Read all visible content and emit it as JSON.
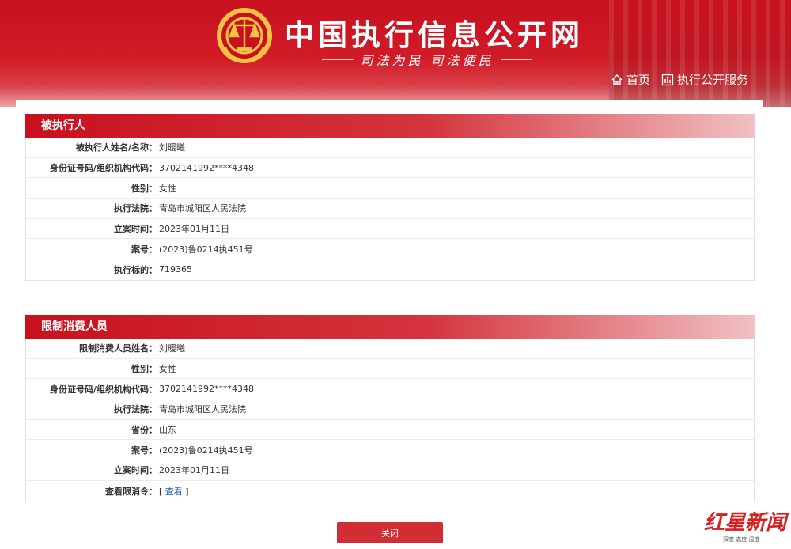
{
  "header": {
    "site_title": "中国执行信息公开网",
    "slogan": "司法为民  司法便民",
    "nav": [
      {
        "label": "首页",
        "icon": "home-icon"
      },
      {
        "label": "执行公开服务",
        "icon": "bar-chart-icon"
      }
    ]
  },
  "sections": [
    {
      "title": "被执行人",
      "rows": [
        {
          "label": "被执行人姓名/名称：",
          "value": "刘暖曦"
        },
        {
          "label": "身份证号码/组织机构代码：",
          "value": "3702141992****4348"
        },
        {
          "label": "性别：",
          "value": "女性"
        },
        {
          "label": "执行法院：",
          "value": "青岛市城阳区人民法院"
        },
        {
          "label": "立案时间：",
          "value": "2023年01月11日"
        },
        {
          "label": "案号：",
          "value": "(2023)鲁0214执451号"
        },
        {
          "label": "执行标的：",
          "value": "719365"
        }
      ]
    },
    {
      "title": "限制消费人员",
      "rows": [
        {
          "label": "限制消费人员姓名：",
          "value": "刘暖曦"
        },
        {
          "label": "性别：",
          "value": "女性"
        },
        {
          "label": "身份证号码/组织机构代码：",
          "value": "3702141992****4348"
        },
        {
          "label": "执行法院：",
          "value": "青岛市城阳区人民法院"
        },
        {
          "label": "省份：",
          "value": "山东"
        },
        {
          "label": "案号：",
          "value": "(2023)鲁0214执451号"
        },
        {
          "label": "立案时间：",
          "value": "2023年01月11日"
        },
        {
          "label": "查看限消令：",
          "link_open": "[ ",
          "link_text": "查看",
          "link_close": " ]"
        }
      ]
    }
  ],
  "close_button": {
    "label": "关闭"
  },
  "watermark": {
    "brand": "红星新闻",
    "tagline": "——深度 态度 温度——"
  },
  "colors": {
    "brand_red": "#c8101e",
    "link_blue": "#1a5fb4"
  }
}
